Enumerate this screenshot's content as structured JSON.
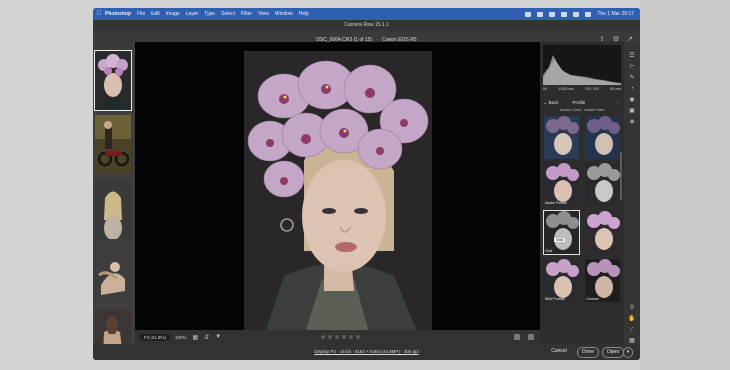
{
  "menubar": {
    "items": [
      "Photoshop",
      "File",
      "Edit",
      "Image",
      "Layer",
      "Type",
      "Select",
      "Filter",
      "View",
      "Window",
      "Help"
    ],
    "clock": "Thu 1 Mar  20:17"
  },
  "window": {
    "title": "Camera Raw 15.1.1"
  },
  "file": {
    "name": "DSC_0064.CR3 (1 of 15)",
    "camera": "Canon EOS R5"
  },
  "zoom": {
    "fit_label": "Fit (21.8%)",
    "preset": "100%"
  },
  "histogram": {
    "readouts": [
      "f/8",
      "1/200 sec",
      "ISO 100",
      "85 mm"
    ]
  },
  "profile_panel": {
    "back_label": "Back",
    "title": "Profile",
    "group": "Adobe Color · Adobe Raw",
    "tooltip": "Vivid",
    "tiles": [
      "",
      "",
      "Adobe Portrait",
      "",
      "Vivid",
      "",
      "B&W Portrait",
      "Contrast"
    ]
  },
  "status": {
    "info": "Display P3 · 16 bit · 8192 × 5464 (44.8MP) · 300 ppi"
  },
  "buttons": {
    "cancel": "Cancel",
    "done": "Done",
    "open": "Open",
    "open_caret": "▾"
  }
}
